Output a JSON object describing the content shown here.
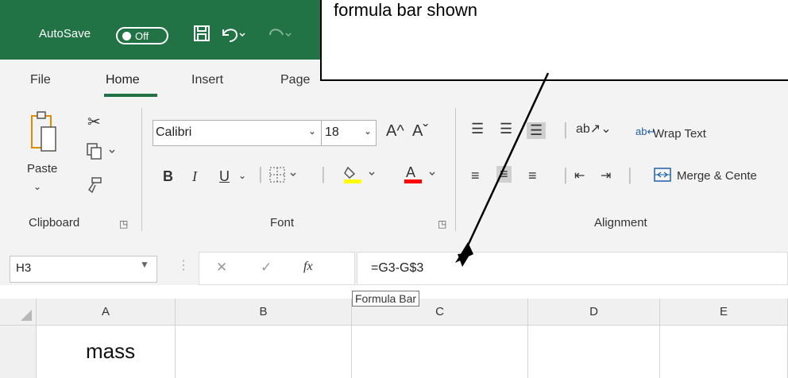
{
  "titlebar": {
    "autosave_label": "AutoSave",
    "autosave_state": "Off",
    "icons": [
      "save-icon",
      "undo-icon",
      "redo-icon"
    ]
  },
  "tabs": [
    {
      "label": "File"
    },
    {
      "label": "Home",
      "active": true
    },
    {
      "label": "Insert"
    },
    {
      "label": "Page"
    }
  ],
  "ribbon": {
    "clipboard": {
      "label": "Clipboard",
      "paste_label": "Paste"
    },
    "font": {
      "label": "Font",
      "font_name": "Calibri",
      "font_size": "18",
      "bold": "B",
      "italic": "I",
      "underline": "U",
      "grow": "A^",
      "shrink": "Aˇ"
    },
    "alignment": {
      "label": "Alignment",
      "wrap_text": "Wrap Text",
      "merge_center": "Merge & Cente"
    }
  },
  "formula_bar": {
    "name_box": "H3",
    "fx": "fx",
    "cancel": "✕",
    "enter": "✓",
    "formula": "=G3-G$3",
    "tooltip": "Formula Bar"
  },
  "columns": [
    "A",
    "B",
    "C",
    "D",
    "E"
  ],
  "cells": {
    "A": "mass"
  },
  "callout": {
    "text": "formula bar shown"
  },
  "colors": {
    "accent": "#217346",
    "highlight_yellow": "#ffff00",
    "font_red": "#ff0000"
  }
}
